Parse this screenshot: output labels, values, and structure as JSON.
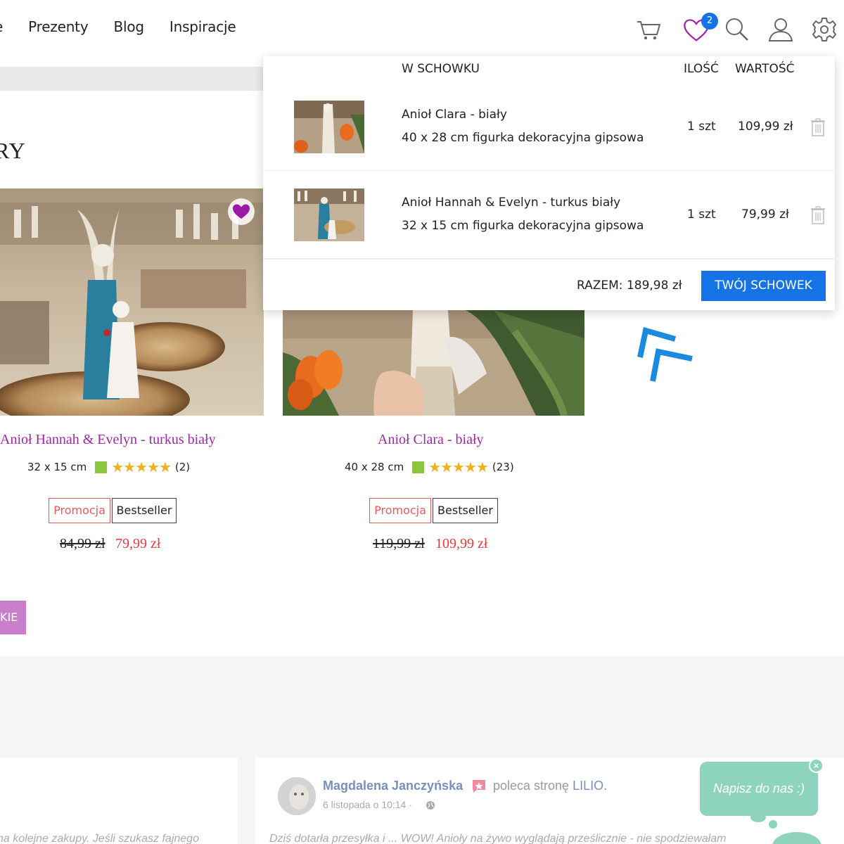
{
  "nav": {
    "items": [
      "e",
      "Prezenty",
      "Blog",
      "Inspiracje"
    ]
  },
  "header": {
    "wishlist_count": "2",
    "icons": [
      "cart-icon",
      "heart-icon",
      "search-icon",
      "user-icon",
      "gear-icon"
    ]
  },
  "section": {
    "title": "RY"
  },
  "products": [
    {
      "name": "Anioł Hannah & Evelyn - turkus biały",
      "size": "32 x 15 cm",
      "rating_count": "(2)",
      "stars": "★★★★★",
      "tag_promo": "Promocja",
      "tag_best": "Bestseller",
      "price_old": "84,99 zł",
      "price_new": "79,99 zł"
    },
    {
      "name": "Anioł Clara - biały",
      "size": "40 x 28 cm",
      "rating_count": "(23)",
      "stars": "★★★★★",
      "tag_promo": "Promocja",
      "tag_best": "Bestseller",
      "price_old": "119,99 zł",
      "price_new": "109,99 zł"
    }
  ],
  "more_button": "KIE",
  "wishlist": {
    "col_items": "W SCHOWKU",
    "col_qty": "ILOŚĆ",
    "col_value": "WARTOŚĆ",
    "items": [
      {
        "name": "Anioł Clara - biały",
        "desc": "40 x 28 cm figurka dekoracyjna gipsowa",
        "qty": "1 szt",
        "value": "109,99 zł"
      },
      {
        "name": "Anioł Hannah & Evelyn - turkus biały",
        "desc": "32 x 15 cm figurka dekoracyjna gipsowa",
        "qty": "1 szt",
        "value": "79,99 zł"
      }
    ],
    "total": "RAZEM: 189,98 zł",
    "button": "TWÓJ SCHOWEK"
  },
  "reviews": [
    {
      "text": "na kolejne zakupy. Jeśli szukasz fajnego"
    },
    {
      "author": "Magdalena Janczyńska",
      "recommends": "poleca stronę",
      "page": "LILIO.",
      "date": "6 listopada o 10:14 ·",
      "text": "Dziś dotarła przesyłka i ... WOW! Anioły na żywo wyglądają prześlicznie - nie spodziewałam"
    }
  ],
  "chat": {
    "label": "Napisz do nas :)",
    "close": "×"
  },
  "colors": {
    "accent_blue": "#1673e6",
    "product_name": "#9b2aa0",
    "price_red": "#e23b3b",
    "chat_mint": "#8dd3be"
  }
}
